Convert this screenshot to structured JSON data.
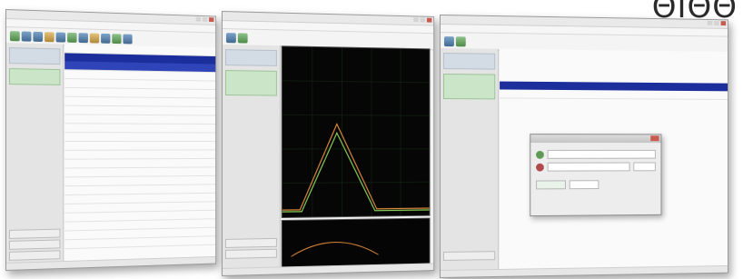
{
  "brand": {
    "text": "ΘΙΘΘ"
  },
  "colors": {
    "accent_blue": "#1c2e9c",
    "plot_bg": "#060606",
    "trace_orange": "#e08a3c",
    "trace_green": "#8ad45a",
    "selected_green": "#cbe5c9"
  },
  "icons": [
    "window-control-icon",
    "close-icon",
    "toolbar-tool-icon"
  ]
}
